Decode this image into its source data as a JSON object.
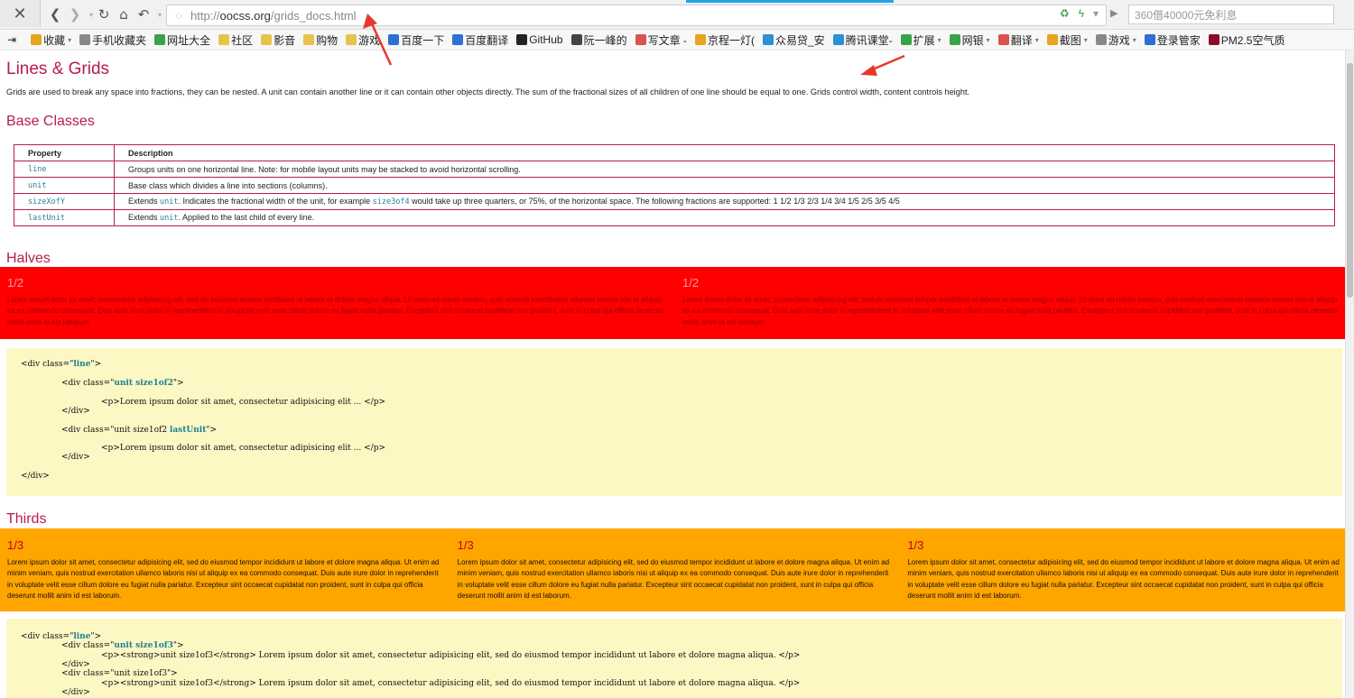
{
  "browser": {
    "logo_glyph": "✕",
    "back_glyph": "❮",
    "forward_glyph": "❯",
    "reload_glyph": "↻",
    "home_glyph": "⌂",
    "undo_glyph": "↶",
    "url_proto": "http://",
    "url_host": "oocss.org",
    "url_path": "/grids_docs.html",
    "search_placeholder": "360借40000元免利息",
    "progress_color": "#1ea5e6"
  },
  "bookmarks": [
    {
      "label": "收藏",
      "icon": "star-icon",
      "color": "#e5a51d",
      "dropdown": true
    },
    {
      "label": "手机收藏夹",
      "icon": "phone-icon",
      "color": "#888"
    },
    {
      "label": "网址大全",
      "icon": "globe-icon",
      "color": "#3aa34a"
    },
    {
      "label": "社区",
      "icon": "folder-icon",
      "color": "#e8c34b"
    },
    {
      "label": "影音",
      "icon": "folder-icon",
      "color": "#e8c34b"
    },
    {
      "label": "购物",
      "icon": "folder-icon",
      "color": "#e8c34b"
    },
    {
      "label": "游戏",
      "icon": "folder-icon",
      "color": "#e8c34b"
    },
    {
      "label": "百度一下",
      "icon": "baidu-icon",
      "color": "#2d6fd5"
    },
    {
      "label": "百度翻译",
      "icon": "translate-icon",
      "color": "#2d6fd5"
    },
    {
      "label": "GitHub",
      "icon": "github-icon",
      "color": "#222"
    },
    {
      "label": "阮一峰的",
      "icon": "pen-icon",
      "color": "#444"
    },
    {
      "label": "写文章 -",
      "icon": "article-icon",
      "color": "#d9534f"
    },
    {
      "label": "京程一灯(",
      "icon": "lamp-icon",
      "color": "#e5a51d"
    },
    {
      "label": "众易贷_安",
      "icon": "loan-icon",
      "color": "#2d8fd5"
    },
    {
      "label": "腾讯课堂-",
      "icon": "tencent-icon",
      "color": "#2d8fd5"
    },
    {
      "label": "扩展",
      "icon": "extension-icon",
      "color": "#3aa34a",
      "dropdown": true
    },
    {
      "label": "网银",
      "icon": "bank-icon",
      "color": "#3aa34a",
      "dropdown": true
    },
    {
      "label": "翻译",
      "icon": "translate-icon",
      "color": "#d9534f",
      "dropdown": true
    },
    {
      "label": "截图",
      "icon": "screenshot-icon",
      "color": "#e5a51d",
      "dropdown": true
    },
    {
      "label": "游戏",
      "icon": "game-icon",
      "color": "#888",
      "dropdown": true
    },
    {
      "label": "登录管家",
      "icon": "login-icon",
      "color": "#2d6fd5"
    },
    {
      "label": "PM2.5空气质",
      "icon": "pm25-icon",
      "color": "#8b0a2a"
    }
  ],
  "page": {
    "title": "Lines & Grids",
    "intro": "Grids are used to break any space into fractions, they can be nested. A unit can contain another line or it can contain other objects directly. The sum of the fractional sizes of all children of one line should be equal to one. Grids control width, content controls height.",
    "accent_color": "#b81c4d"
  },
  "base_classes": {
    "heading": "Base Classes",
    "columns": [
      "Property",
      "Description"
    ],
    "rows": [
      {
        "prop": "line",
        "desc_pre": "Groups units on one horizontal line. Note: for mobile layout units may be stacked to avoid horizontal scrolling.",
        "desc_code": "",
        "desc_mid": "",
        "desc_code2": "",
        "desc_post": ""
      },
      {
        "prop": "unit",
        "desc_pre": "Base class which divides a line into sections (columns).",
        "desc_code": "",
        "desc_mid": "",
        "desc_code2": "",
        "desc_post": ""
      },
      {
        "prop": "sizeXofY",
        "desc_pre": "Extends ",
        "desc_code": "unit",
        "desc_mid": ". Indicates the fractional width of the unit, for example ",
        "desc_code2": "size3of4",
        "desc_post": " would take up three quarters, or 75%, of the horizontal space. The following fractions are supported: 1 1/2 1/3 2/3 1/4 3/4 1/5 2/5 3/5 4/5"
      },
      {
        "prop": "lastUnit",
        "desc_pre": "Extends ",
        "desc_code": "unit",
        "desc_mid": ". Applied to the last child of every line.",
        "desc_code2": "",
        "desc_post": ""
      }
    ]
  },
  "halves": {
    "heading": "Halves",
    "color": "#ff0000",
    "units": [
      {
        "fraction": "1/2",
        "text": "Lorem ipsum dolor sit amet, consectetur adipisicing elit, sed do eiusmod tempor incididunt ut labore et dolore magna aliqua. Ut enim ad minim veniam, quis nostrud exercitation ullamco laboris nisi ut aliquip ex ea commodo consequat. Duis aute irure dolor in reprehenderit in voluptate velit esse cillum dolore eu fugiat nulla pariatur. Excepteur sint occaecat cupidatat non proident, sunt in culpa qui officia deserunt mollit anim id est laborum."
      },
      {
        "fraction": "1/2",
        "text": "Lorem ipsum dolor sit amet, consectetur adipisicing elit, sed do eiusmod tempor incididunt ut labore et dolore magna aliqua. Ut enim ad minim veniam, quis nostrud exercitation ullamco laboris nisi ut aliquip ex ea commodo consequat. Duis aute irure dolor in reprehenderit in voluptate velit esse cillum dolore eu fugiat nulla pariatur. Excepteur sint occaecat cupidatat non proident, sunt in culpa qui officia deserunt mollit anim id est laborum."
      }
    ],
    "code": {
      "l1a": "<div class=\"",
      "l1b": "line",
      "l1c": "\">",
      "l2a": "<div class=\"",
      "l2b": "unit size1of2",
      "l2c": "\">",
      "l3": "<p>Lorem ipsum dolor sit amet, consectetur adipisicing elit ... </p>",
      "l4": "</div>",
      "l5a": "<div class=\"unit size1of2 ",
      "l5b": "lastUnit",
      "l5c": "\">",
      "l6": "<p>Lorem ipsum dolor sit amet, consectetur adipisicing elit ... </p>",
      "l7": "</div>",
      "l8": "</div>"
    }
  },
  "thirds": {
    "heading": "Thirds",
    "color": "#ffa500",
    "units": [
      {
        "fraction": "1/3",
        "text": "Lorem ipsum dolor sit amet, consectetur adipisicing elit, sed do eiusmod tempor incididunt ut labore et dolore magna aliqua. Ut enim ad minim veniam, quis nostrud exercitation ullamco laboris nisi ut aliquip ex ea commodo consequat. Duis aute irure dolor in reprehenderit in voluptate velit esse cillum dolore eu fugiat nulla pariatur. Excepteur sint occaecat cupidatat non proident, sunt in culpa qui officia deserunt mollit anim id est laborum."
      },
      {
        "fraction": "1/3",
        "text": "Lorem ipsum dolor sit amet, consectetur adipisicing elit, sed do eiusmod tempor incididunt ut labore et dolore magna aliqua. Ut enim ad minim veniam, quis nostrud exercitation ullamco laboris nisi ut aliquip ex ea commodo consequat. Duis aute irure dolor in reprehenderit in voluptate velit esse cillum dolore eu fugiat nulla pariatur. Excepteur sint occaecat cupidatat non proident, sunt in culpa qui officia deserunt mollit anim id est laborum."
      },
      {
        "fraction": "1/3",
        "text": "Lorem ipsum dolor sit amet, consectetur adipisicing elit, sed do eiusmod tempor incididunt ut labore et dolore magna aliqua. Ut enim ad minim veniam, quis nostrud exercitation ullamco laboris nisi ut aliquip ex ea commodo consequat. Duis aute irure dolor in reprehenderit in voluptate velit esse cillum dolore eu fugiat nulla pariatur. Excepteur sint occaecat cupidatat non proident, sunt in culpa qui officia deserunt mollit anim id est laborum."
      }
    ],
    "code": {
      "l1a": "<div class=\"",
      "l1b": "line",
      "l1c": "\">",
      "l2a": "<div class=\"",
      "l2b": "unit size1of3",
      "l2c": "\">",
      "l3": "<p><strong>unit size1of3</strong> Lorem ipsum dolor sit amet, consectetur adipisicing elit, sed do eiusmod tempor incididunt ut labore et dolore magna aliqua. </p>",
      "l4": "</div>",
      "l5": "<div class=\"unit size1of3\">",
      "l6": "<p><strong>unit size1of3</strong> Lorem ipsum dolor sit amet, consectetur adipisicing elit, sed do eiusmod tempor incididunt ut labore et dolore magna aliqua. </p>",
      "l7": "</div>"
    }
  },
  "annotations": {
    "arrow_color": "#e8382b"
  }
}
